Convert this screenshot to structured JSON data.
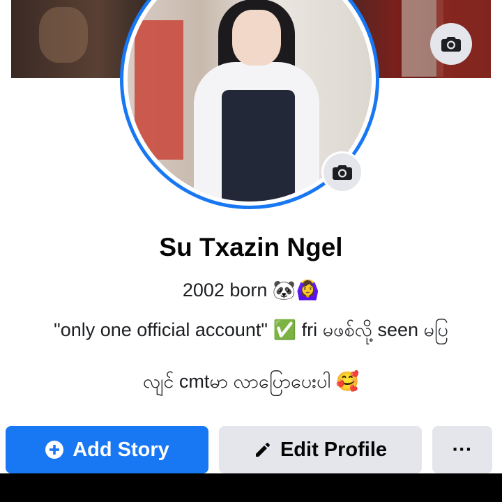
{
  "profile": {
    "name": "Su Txazin Ngel",
    "bio_line1": "2002 born 🐼🙆‍♀️",
    "bio_line2": "\"only one official  account\" ✅ fri မဖစ်လို့ seen မပြ",
    "bio_line3": "လျင် cmtမာ လာပြောပေးပါ 🥰"
  },
  "actions": {
    "add_story_label": "Add Story",
    "edit_profile_label": "Edit Profile",
    "more_label": "···"
  },
  "icons": {
    "cover_camera": "camera-icon",
    "avatar_camera": "camera-icon",
    "add": "plus-circle-icon",
    "edit": "pencil-icon"
  },
  "colors": {
    "accent": "#1877f2",
    "button_secondary": "#e4e6eb",
    "text_primary": "#050505"
  }
}
